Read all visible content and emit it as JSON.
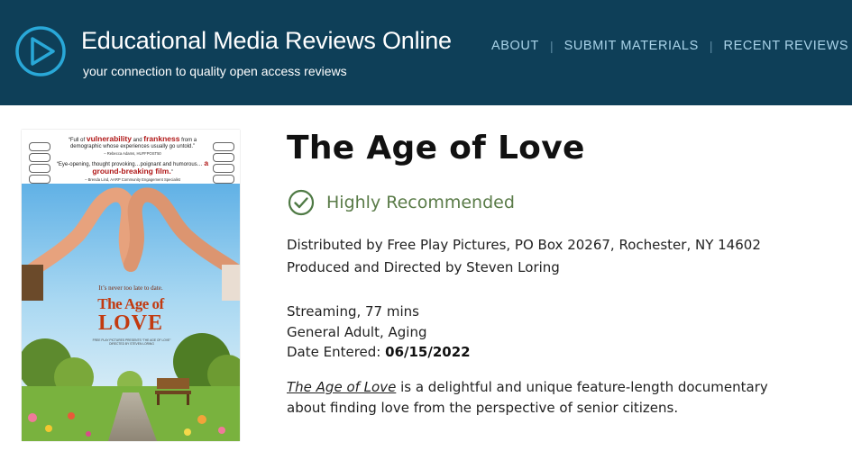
{
  "header": {
    "site_title": "Educational Media Reviews Online",
    "tagline": "your connection to quality open access reviews",
    "nav": [
      {
        "label": "ABOUT"
      },
      {
        "label": "SUBMIT MATERIALS"
      },
      {
        "label": "RECENT REVIEWS"
      }
    ],
    "separator": "|"
  },
  "poster": {
    "quote1_pre": "“Full of ",
    "quote1_b1": "vulnerability",
    "quote1_mid": " and ",
    "quote1_b2": "frankness",
    "quote1_post": " from a demographic whose experiences usually go untold.”",
    "quote1_source": "– Rebecca Adams, HUFFPOST50",
    "quote2_pre": "“Eye-opening, thought provoking…poignant and humorous… ",
    "quote2_b": "a ground-breaking film.",
    "quote2_post": "”",
    "quote2_source": "– Brenda Lind, AARP Community Engagement Specialist",
    "tagline": "It’s never too late to date.",
    "title_line1": "The Age of",
    "title_line2": "LOVE",
    "credits": "FREE PLAY PICTURES PRESENTS “THE AGE OF LOVE” DIRECTED BY STEVEN LORING"
  },
  "review": {
    "title": "The Age of Love",
    "rating": "Highly Recommended",
    "distributed_by": "Distributed by Free Play Pictures, PO Box 20267, Rochester, NY 14602",
    "produced_by": "Produced and Directed by Steven Loring",
    "format": "Streaming, 77 mins",
    "audience": "General Adult, Aging",
    "date_label": "Date Entered:",
    "date_value": "06/15/2022",
    "description_film": "The Age of Love",
    "description_rest": " is a delightful and unique feature-length documentary about finding love from the perspective of senior citizens."
  },
  "colors": {
    "header_bg": "#0e3f58",
    "nav_link": "#a9d3e9",
    "rating_green": "#5a7b48"
  },
  "icons": {
    "logo": "play-circle-icon",
    "rating": "check-circle-icon"
  }
}
